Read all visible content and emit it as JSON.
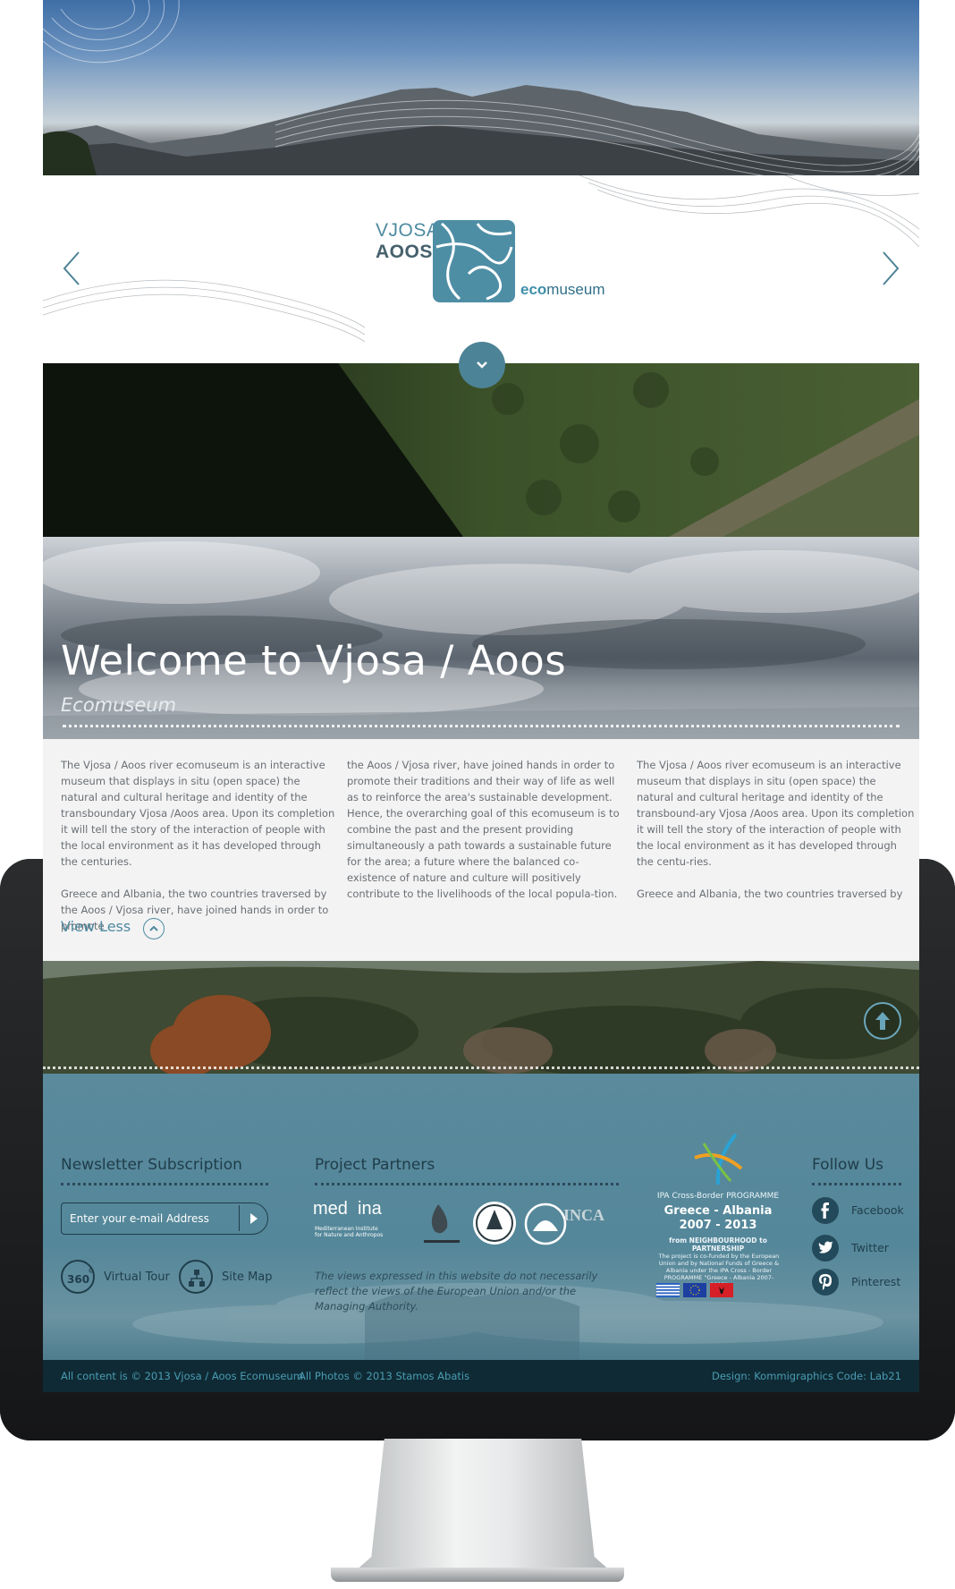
{
  "header": {
    "logo_line1": "VJOSA",
    "logo_line2": "AOOS",
    "logo_eco": "eco",
    "logo_museum": "museum"
  },
  "welcome": {
    "title": "Welcome to Vjosa / Aoos",
    "subtitle": "Ecomuseum"
  },
  "intro": {
    "col1": [
      "The Vjosa / Aoos river ecomuseum is an interactive museum that displays in situ (open space) the natural and cultural heritage and identity of the transboundary Vjosa /Aoos area.  Upon its completion it will tell the story of the interaction of people with the local environment as it has developed through the centuries.",
      "Greece and Albania, the two countries traversed by the Aoos / Vjosa river, have joined hands in order to promote"
    ],
    "col2": [
      " the Aoos / Vjosa river, have joined hands in order to promote their traditions and their way of life as well as to reinforce the area's sustainable development. Hence, the overarching goal of this ecomuseum is to combine the past and the present providing simultaneously a path towards a sustainable future for the area; a future where the balanced co-existence of nature and culture will positively contribute to the livelihoods of the local popula-tion."
    ],
    "col3": [
      "The Vjosa / Aoos river ecomuseum is an interactive museum that displays in situ (open space) the natural and cultural heritage and identity of the transbound-ary Vjosa /Aoos area.  Upon its completion it will tell the story of the interaction of people with the local environment as it has developed through the centu-ries.",
      "Greece and Albania, the two countries traversed by"
    ],
    "view_less": "View Less"
  },
  "footer": {
    "newsletter_heading": "Newsletter Subscription",
    "email_placeholder": "Enter your e-mail Address",
    "virtual_tour": "Virtual Tour",
    "site_map": "Site Map",
    "partners_heading": "Project Partners",
    "partner_medina": "med  ina",
    "partner_medina_sub1": "Mediterranean Institute",
    "partner_medina_sub2": "for Nature and Anthropos",
    "partner_inca": "INCA",
    "disclaimer": "The views expressed in this website do not necessarily reflect the views of the European Union and/or the Managing Authority.",
    "ipa_line1": "IPA Cross-Border PROGRAMME",
    "ipa_line2": "Greece - Albania",
    "ipa_line3": "2007 - 2013",
    "ipa_line4": "from NEIGHBOURHOOD to PARTNERSHIP",
    "ipa_note": "The project is co-funded by the European Union and by National Funds of Greece & Albania under the IPA Cross - Border PROGRAMME \"Greece - Albania 2007-2013\"",
    "follow_heading": "Follow Us",
    "social": [
      {
        "label": "Facebook",
        "icon": "facebook-icon"
      },
      {
        "label": "Twitter",
        "icon": "twitter-icon"
      },
      {
        "label": "Pinterest",
        "icon": "pinterest-icon"
      }
    ]
  },
  "bottom_bar": {
    "copyright": "All content is © 2013 Vjosa / Aoos Ecomuseum",
    "photos": "All Photos © 2013  Stamos Abatis",
    "credits": "Design: Kommigraphics   Code: Lab21"
  },
  "colors": {
    "accent": "#4d8396",
    "footer_bg": "#5a8a9c",
    "bottom_bar": "#0f2a34",
    "text_section_bg": "#f3f3f4"
  }
}
